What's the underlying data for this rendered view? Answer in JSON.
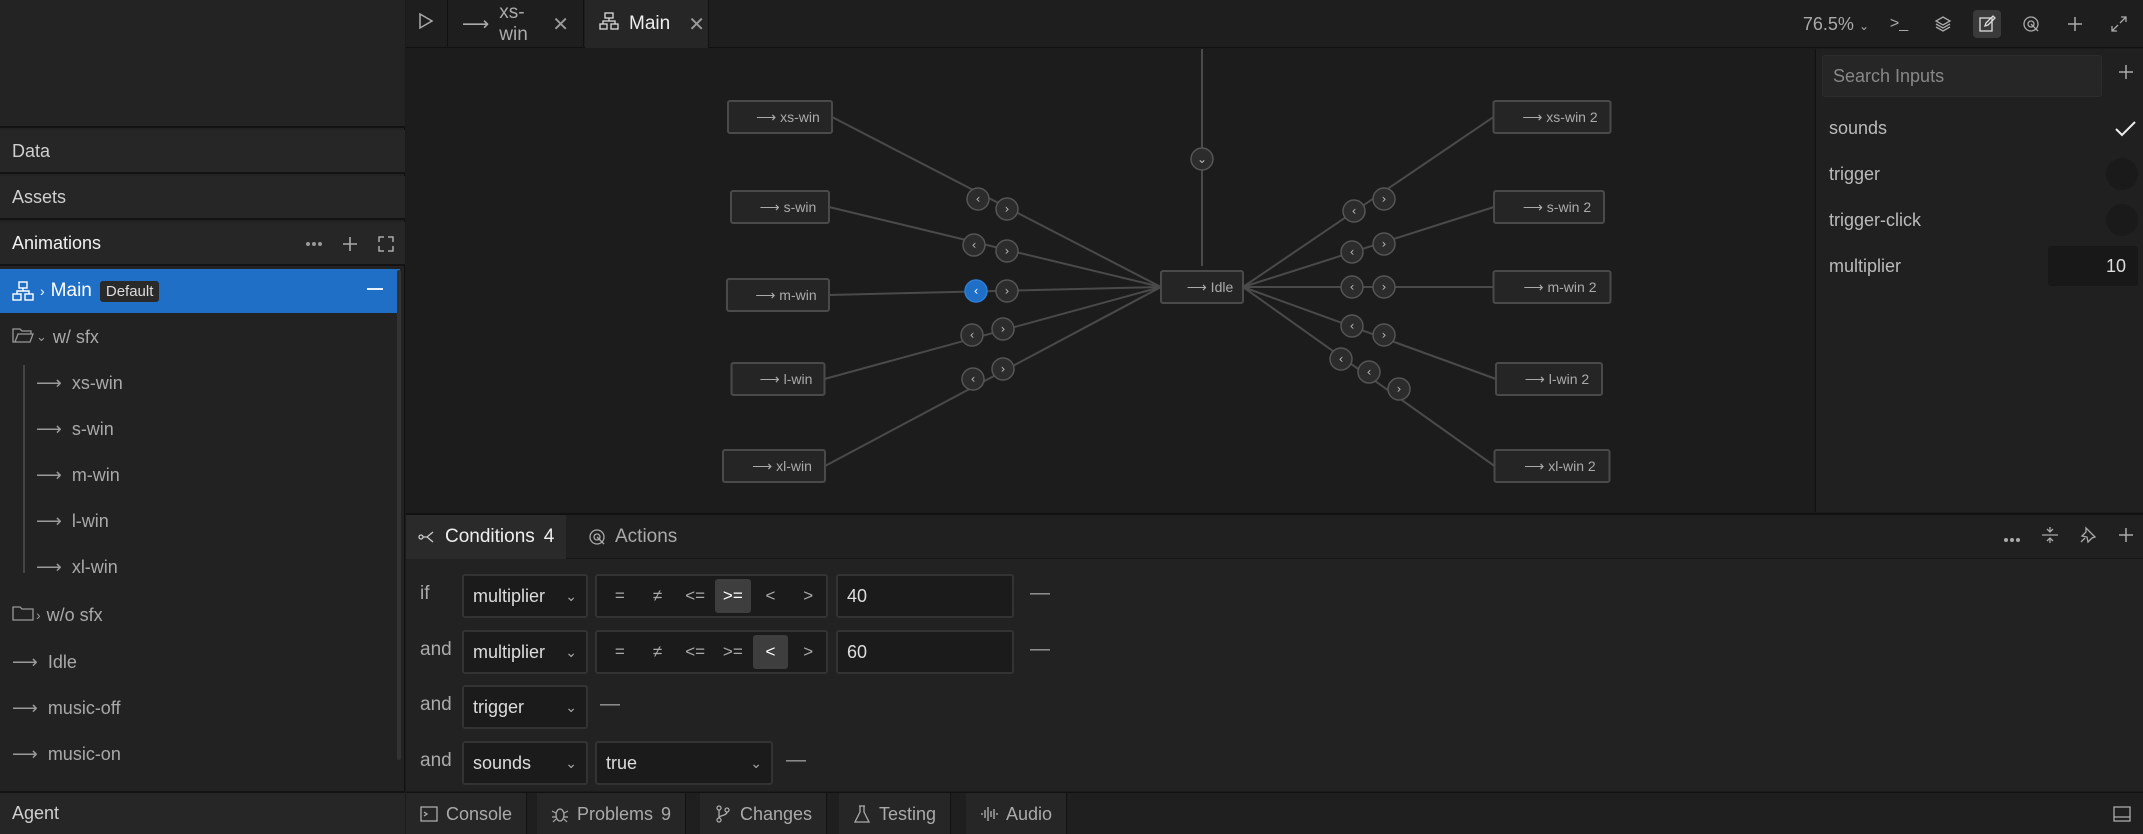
{
  "left": {
    "sections": {
      "data": "Data",
      "assets": "Assets",
      "animations": "Animations",
      "agent": "Agent"
    },
    "tree": {
      "main": "Main",
      "main_badge": "Default",
      "folder_sfx": "w/ sfx",
      "sfx_items": [
        "xs-win",
        "s-win",
        "m-win",
        "l-win",
        "xl-win"
      ],
      "folder_nosfx": "w/o sfx",
      "root_items": [
        "Idle",
        "music-off",
        "music-on"
      ]
    }
  },
  "tabs": {
    "tab1": "xs-win",
    "tab2": "Main",
    "zoom": "76.5%"
  },
  "graph": {
    "left_nodes": [
      "xs-win",
      "s-win",
      "m-win",
      "l-win",
      "xl-win"
    ],
    "center": "Idle",
    "right_nodes": [
      "xs-win 2",
      "s-win 2",
      "m-win 2",
      "l-win 2",
      "xl-win 2"
    ]
  },
  "inputs": {
    "search_placeholder": "Search Inputs",
    "items": [
      {
        "name": "sounds",
        "type": "boolean",
        "value": true
      },
      {
        "name": "trigger",
        "type": "trigger"
      },
      {
        "name": "trigger-click",
        "type": "trigger"
      },
      {
        "name": "multiplier",
        "type": "number",
        "value": "10"
      }
    ]
  },
  "conditions": {
    "tab_conditions": "Conditions",
    "count": "4",
    "tab_actions": "Actions",
    "operators": [
      "=",
      "≠",
      "<=",
      ">=",
      "<",
      ">"
    ],
    "rows": [
      {
        "kw": "if",
        "input": "multiplier",
        "op_selected": 3,
        "value": "40"
      },
      {
        "kw": "and",
        "input": "multiplier",
        "op_selected": 4,
        "value": "60"
      },
      {
        "kw": "and",
        "input": "trigger"
      },
      {
        "kw": "and",
        "input": "sounds",
        "bool": "true"
      }
    ]
  },
  "bottom": {
    "console": "Console",
    "problems": "Problems",
    "problems_count": "9",
    "changes": "Changes",
    "testing": "Testing",
    "audio": "Audio"
  }
}
